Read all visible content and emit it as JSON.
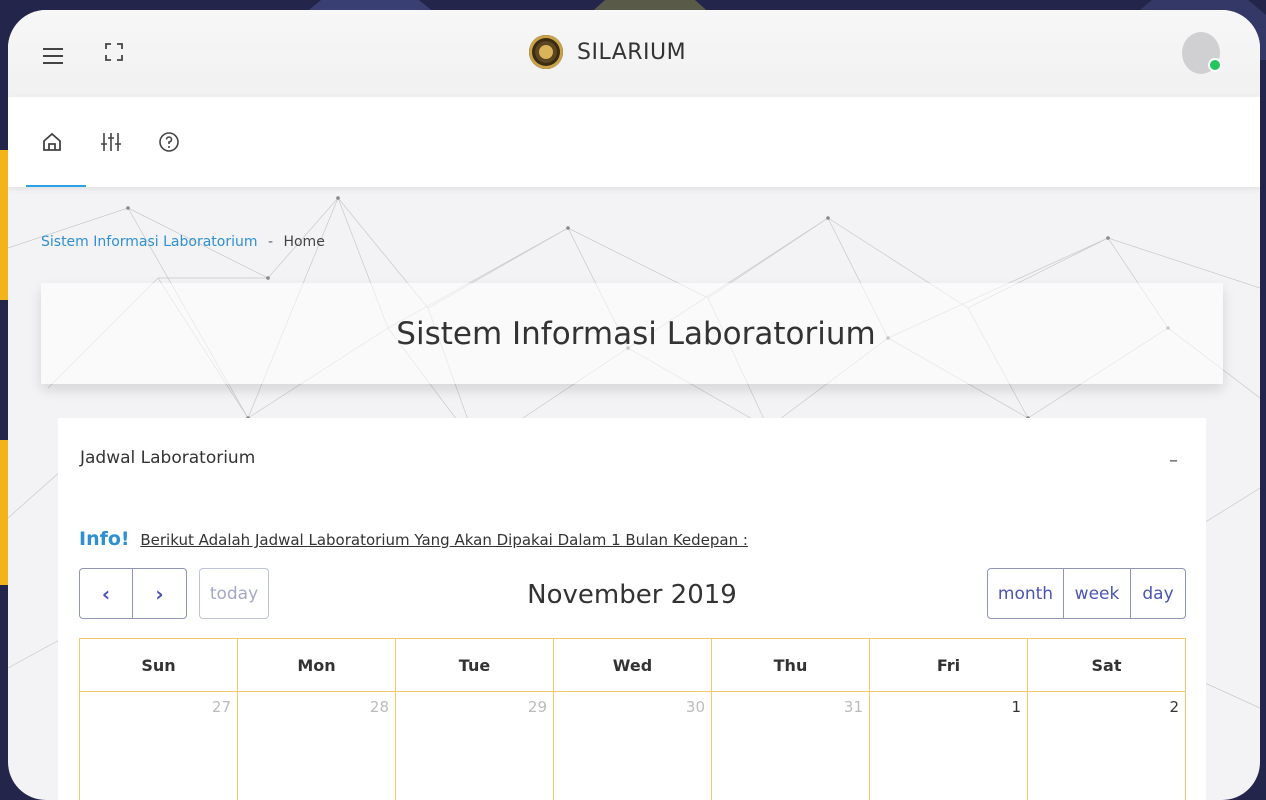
{
  "app": {
    "brand_name": "SILARIUM"
  },
  "colors": {
    "accent": "#2e8fd1",
    "calendar_border": "#f2c96a",
    "button": "#4a54b5",
    "online": "#22c55e"
  },
  "icons": {
    "menu": "hamburger-icon",
    "fullscreen": "fullscreen-icon",
    "home": "home-icon",
    "settings": "sliders-icon",
    "help": "help-icon"
  },
  "breadcrumb": {
    "root": "Sistem Informasi Laboratorium",
    "separator": "-",
    "current": "Home"
  },
  "page_title": "Sistem Informasi Laboratorium",
  "card": {
    "header": "Jadwal Laboratorium",
    "collapse_symbol": "–",
    "info_label": "Info!",
    "info_text": "Berikut Adalah Jadwal Laboratorium Yang Akan Dipakai Dalam 1 Bulan Kedepan :"
  },
  "calendar": {
    "prev_label": "‹",
    "next_label": "›",
    "today_label": "today",
    "title": "November 2019",
    "views": [
      "month",
      "week",
      "day"
    ],
    "weekdays": [
      "Sun",
      "Mon",
      "Tue",
      "Wed",
      "Thu",
      "Fri",
      "Sat"
    ],
    "week1": [
      "27",
      "28",
      "29",
      "30",
      "31",
      "1",
      "2"
    ]
  }
}
